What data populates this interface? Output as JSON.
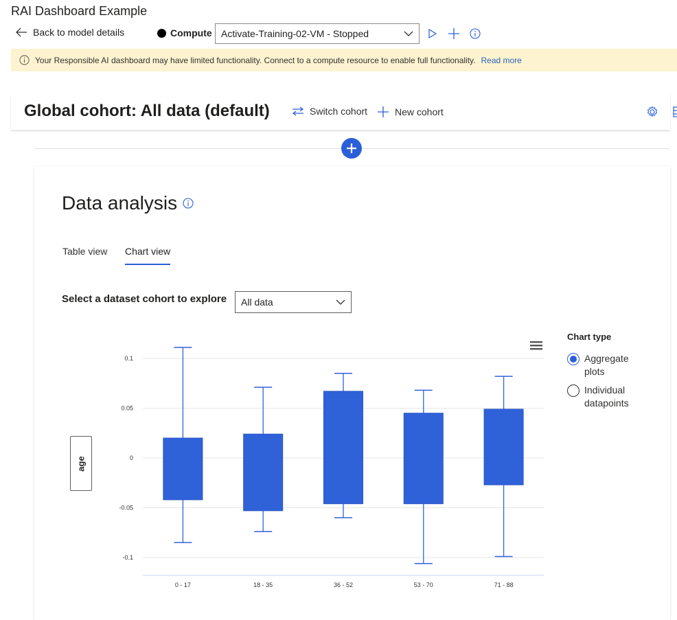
{
  "app": {
    "title": "RAI Dashboard Example"
  },
  "header": {
    "back_label": "Back to model details",
    "compute_label": "Compute",
    "compute_select_value": "Activate-Training-02-VM - Stopped"
  },
  "banner": {
    "message": "Your Responsible AI dashboard may have limited functionality. Connect to a compute resource to enable full functionality.",
    "link": "Read more"
  },
  "cohort": {
    "title": "Global cohort: All data (default)",
    "switch_label": "Switch cohort",
    "new_label": "New cohort"
  },
  "data_analysis": {
    "title": "Data analysis",
    "tabs": [
      {
        "label": "Table view",
        "active": false
      },
      {
        "label": "Chart view",
        "active": true
      }
    ],
    "cohort_select_label": "Select a dataset cohort to explore",
    "cohort_select_value": "All data",
    "y_axis_button": "age",
    "chart_type_label": "Chart type",
    "chart_type_options": [
      {
        "label": "Aggregate plots",
        "selected": true
      },
      {
        "label": "Individual datapoints",
        "selected": false
      }
    ]
  },
  "colors": {
    "accent": "#2b5fd9",
    "box_fill": "#2f62d9",
    "banner_bg": "#fdf3d0",
    "link": "#2a62b8"
  },
  "chart_data": {
    "type": "box",
    "categories": [
      "0 - 17",
      "18 - 35",
      "36 - 52",
      "53 - 70",
      "71 - 88"
    ],
    "boxes": [
      {
        "min": -0.085,
        "q1": -0.042,
        "q3": 0.02,
        "max": 0.111
      },
      {
        "min": -0.074,
        "q1": -0.053,
        "q3": 0.024,
        "max": 0.071
      },
      {
        "min": -0.06,
        "q1": -0.046,
        "q3": 0.067,
        "max": 0.085
      },
      {
        "min": -0.106,
        "q1": -0.046,
        "q3": 0.045,
        "max": 0.068
      },
      {
        "min": -0.099,
        "q1": -0.027,
        "q3": 0.049,
        "max": 0.082
      }
    ],
    "y_ticks": [
      "0.1",
      "0.05",
      "0",
      "-0.05",
      "-0.1"
    ],
    "y_tick_values": [
      0.1,
      0.05,
      0,
      -0.05,
      -0.1
    ],
    "ylim": [
      -0.118,
      0.118
    ],
    "ylabel": "age",
    "grid": true
  }
}
